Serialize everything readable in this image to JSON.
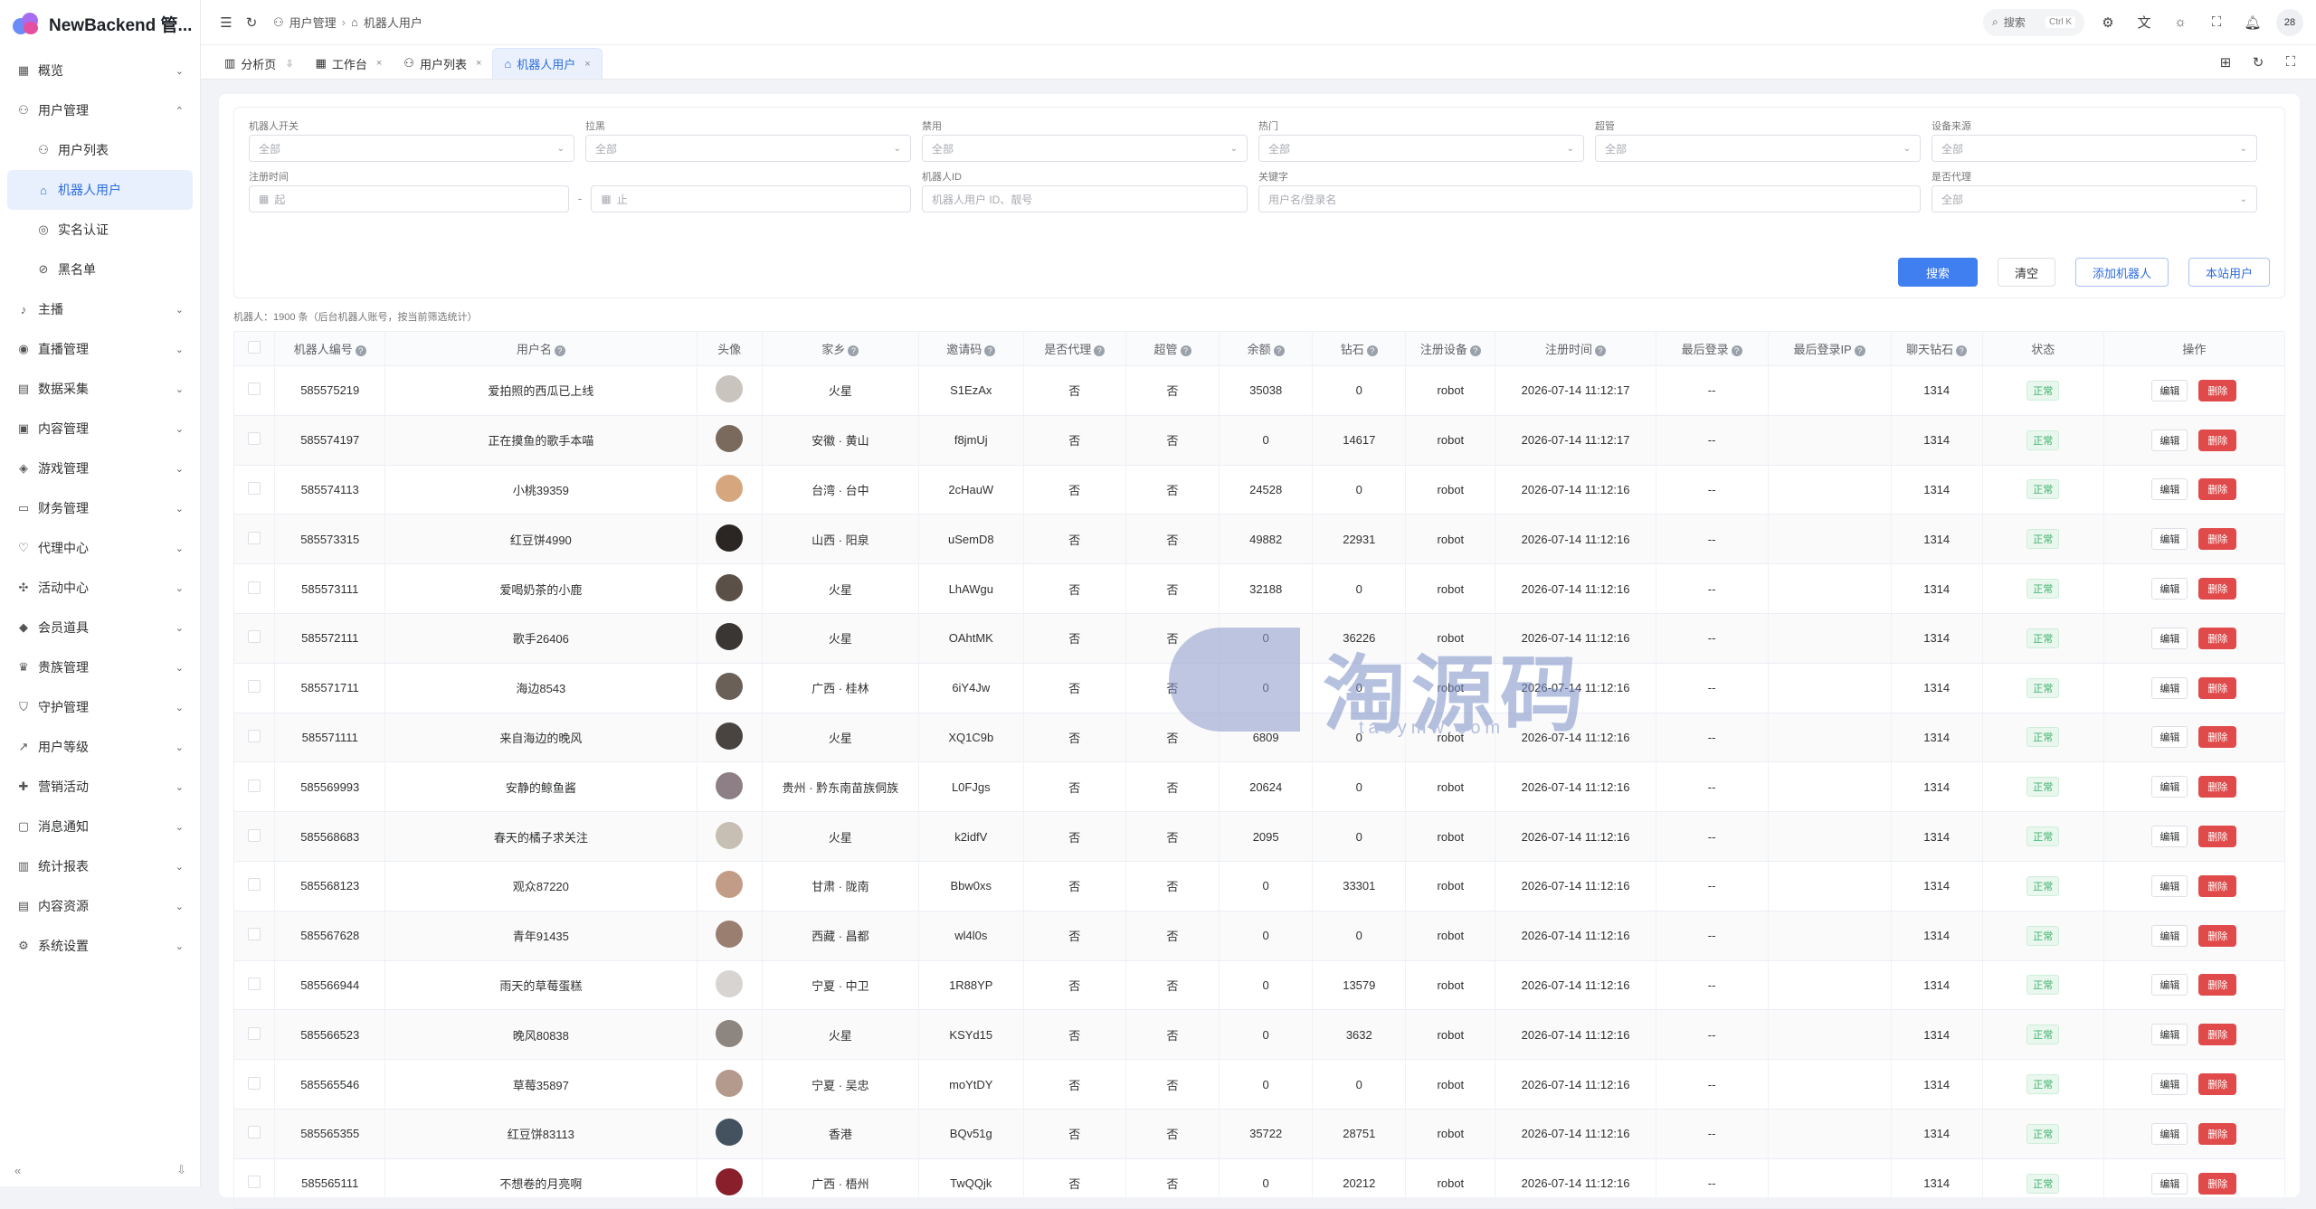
{
  "app": {
    "title": "NewBackend 管...",
    "user_badge": "28"
  },
  "sidebar": {
    "items": [
      {
        "label": "概览",
        "icon": "grid-icon",
        "chev": "⌄"
      },
      {
        "label": "用户管理",
        "icon": "user-icon",
        "chev": "⌃"
      },
      {
        "label": "用户列表",
        "icon": "user-icon",
        "sub": true
      },
      {
        "label": "机器人用户",
        "icon": "robot-icon",
        "sub": true,
        "active": true
      },
      {
        "label": "实名认证",
        "icon": "id-icon",
        "sub": true
      },
      {
        "label": "黑名单",
        "icon": "block-icon",
        "sub": true
      },
      {
        "label": "主播",
        "icon": "mic-icon",
        "chev": "⌄"
      },
      {
        "label": "直播管理",
        "icon": "live-icon",
        "chev": "⌄"
      },
      {
        "label": "数据采集",
        "icon": "database-icon",
        "chev": "⌄"
      },
      {
        "label": "内容管理",
        "icon": "content-icon",
        "chev": "⌄"
      },
      {
        "label": "游戏管理",
        "icon": "game-icon",
        "chev": "⌄"
      },
      {
        "label": "财务管理",
        "icon": "wallet-icon",
        "chev": "⌄"
      },
      {
        "label": "代理中心",
        "icon": "agent-icon",
        "chev": "⌄"
      },
      {
        "label": "活动中心",
        "icon": "activity-icon",
        "chev": "⌄"
      },
      {
        "label": "会员道具",
        "icon": "diamond-icon",
        "chev": "⌄"
      },
      {
        "label": "贵族管理",
        "icon": "crown-icon",
        "chev": "⌄"
      },
      {
        "label": "守护管理",
        "icon": "shield-icon",
        "chev": "⌄"
      },
      {
        "label": "用户等级",
        "icon": "trend-icon",
        "chev": "⌄"
      },
      {
        "label": "营销活动",
        "icon": "gift-icon",
        "chev": "⌄"
      },
      {
        "label": "消息通知",
        "icon": "message-icon",
        "chev": "⌄"
      },
      {
        "label": "统计报表",
        "icon": "chart-icon",
        "chev": "⌄"
      },
      {
        "label": "内容资源",
        "icon": "folder-icon",
        "chev": "⌄"
      },
      {
        "label": "系统设置",
        "icon": "gear-icon",
        "chev": "⌄"
      }
    ],
    "collapse": "«",
    "pin": "⇩"
  },
  "header": {
    "breadcrumb": [
      "用户管理",
      "机器人用户"
    ],
    "search_label": "搜索",
    "search_kbd": "Ctrl K"
  },
  "tabs": [
    {
      "label": "分析页",
      "icon": "chart-icon",
      "close": "⇩"
    },
    {
      "label": "工作台",
      "icon": "desk-icon",
      "close": "×"
    },
    {
      "label": "用户列表",
      "icon": "user-icon",
      "close": "×"
    },
    {
      "label": "机器人用户",
      "icon": "robot-icon",
      "close": "×",
      "active": true
    }
  ],
  "filters": {
    "row1": [
      {
        "label": "机器人开关",
        "value": "全部"
      },
      {
        "label": "拉黑",
        "value": "全部"
      },
      {
        "label": "禁用",
        "value": "全部"
      },
      {
        "label": "热门",
        "value": "全部"
      },
      {
        "label": "超管",
        "value": "全部"
      },
      {
        "label": "设备来源",
        "value": "全部"
      }
    ],
    "reg_time_label": "注册时间",
    "start_placeholder": "起",
    "dash": "-",
    "end_placeholder": "止",
    "robot_id_label": "机器人ID",
    "robot_id_placeholder": "机器人用户 ID、靓号",
    "keyword_label": "关键字",
    "keyword_placeholder": "用户名/登录名",
    "agent_label": "是否代理",
    "agent_value": "全部",
    "buttons": {
      "search": "搜索",
      "clear": "清空",
      "add": "添加机器人",
      "local": "本站用户"
    }
  },
  "summary": "机器人：1900 条（后台机器人账号，按当前筛选统计）",
  "table": {
    "headers": [
      "机器人编号",
      "用户名",
      "头像",
      "家乡",
      "邀请码",
      "是否代理",
      "超管",
      "余额",
      "钻石",
      "注册设备",
      "注册时间",
      "最后登录",
      "最后登录IP",
      "聊天钻石",
      "状态",
      "操作"
    ],
    "edit_label": "编辑",
    "delete_label": "删除",
    "rows": [
      {
        "id": "585575219",
        "name": "爱拍照的西瓜已上线",
        "home": "火星",
        "code": "S1EzAx",
        "agent": "否",
        "admin": "否",
        "balance": "35038",
        "diamond": "0",
        "device": "robot",
        "reg": "2026-07-14 11:12:17",
        "last": "--",
        "ip": "",
        "chat": "1314",
        "status": "正常",
        "color": "#c9c4bd"
      },
      {
        "id": "585574197",
        "name": "正在摸鱼的歌手本喵",
        "home": "安徽 · 黄山",
        "code": "f8jmUj",
        "agent": "否",
        "admin": "否",
        "balance": "0",
        "diamond": "14617",
        "device": "robot",
        "reg": "2026-07-14 11:12:17",
        "last": "--",
        "ip": "",
        "chat": "1314",
        "status": "正常",
        "color": "#7a6a5e"
      },
      {
        "id": "585574113",
        "name": "小桃39359",
        "home": "台湾 · 台中",
        "code": "2cHauW",
        "agent": "否",
        "admin": "否",
        "balance": "24528",
        "diamond": "0",
        "device": "robot",
        "reg": "2026-07-14 11:12:16",
        "last": "--",
        "ip": "",
        "chat": "1314",
        "status": "正常",
        "color": "#d6a77e"
      },
      {
        "id": "585573315",
        "name": "红豆饼4990",
        "home": "山西 · 阳泉",
        "code": "uSemD8",
        "agent": "否",
        "admin": "否",
        "balance": "49882",
        "diamond": "22931",
        "device": "robot",
        "reg": "2026-07-14 11:12:16",
        "last": "--",
        "ip": "",
        "chat": "1314",
        "status": "正常",
        "color": "#2b2623"
      },
      {
        "id": "585573111",
        "name": "爱喝奶茶的小鹿",
        "home": "火星",
        "code": "LhAWgu",
        "agent": "否",
        "admin": "否",
        "balance": "32188",
        "diamond": "0",
        "device": "robot",
        "reg": "2026-07-14 11:12:16",
        "last": "--",
        "ip": "",
        "chat": "1314",
        "status": "正常",
        "color": "#5a5048"
      },
      {
        "id": "585572111",
        "name": "歌手26406",
        "home": "火星",
        "code": "OAhtMK",
        "agent": "否",
        "admin": "否",
        "balance": "0",
        "diamond": "36226",
        "device": "robot",
        "reg": "2026-07-14 11:12:16",
        "last": "--",
        "ip": "",
        "chat": "1314",
        "status": "正常",
        "color": "#3a3634"
      },
      {
        "id": "585571711",
        "name": "海边8543",
        "home": "广西 · 桂林",
        "code": "6iY4Jw",
        "agent": "否",
        "admin": "否",
        "balance": "0",
        "diamond": "0",
        "device": "robot",
        "reg": "2026-07-14 11:12:16",
        "last": "--",
        "ip": "",
        "chat": "1314",
        "status": "正常",
        "color": "#6b6058"
      },
      {
        "id": "585571111",
        "name": "来自海边的晚风",
        "home": "火星",
        "code": "XQ1C9b",
        "agent": "否",
        "admin": "否",
        "balance": "6809",
        "diamond": "0",
        "device": "robot",
        "reg": "2026-07-14 11:12:16",
        "last": "--",
        "ip": "",
        "chat": "1314",
        "status": "正常",
        "color": "#4a4440"
      },
      {
        "id": "585569993",
        "name": "安静的鲸鱼酱",
        "home": "贵州 · 黔东南苗族侗族",
        "code": "L0FJgs",
        "agent": "否",
        "admin": "否",
        "balance": "20624",
        "diamond": "0",
        "device": "robot",
        "reg": "2026-07-14 11:12:16",
        "last": "--",
        "ip": "",
        "chat": "1314",
        "status": "正常",
        "color": "#8e7f86"
      },
      {
        "id": "585568683",
        "name": "春天的橘子求关注",
        "home": "火星",
        "code": "k2idfV",
        "agent": "否",
        "admin": "否",
        "balance": "2095",
        "diamond": "0",
        "device": "robot",
        "reg": "2026-07-14 11:12:16",
        "last": "--",
        "ip": "",
        "chat": "1314",
        "status": "正常",
        "color": "#c7bfb3"
      },
      {
        "id": "585568123",
        "name": "观众87220",
        "home": "甘肃 · 陇南",
        "code": "Bbw0xs",
        "agent": "否",
        "admin": "否",
        "balance": "0",
        "diamond": "33301",
        "device": "robot",
        "reg": "2026-07-14 11:12:16",
        "last": "--",
        "ip": "",
        "chat": "1314",
        "status": "正常",
        "color": "#c29c86"
      },
      {
        "id": "585567628",
        "name": "青年91435",
        "home": "西藏 · 昌都",
        "code": "wl4l0s",
        "agent": "否",
        "admin": "否",
        "balance": "0",
        "diamond": "0",
        "device": "robot",
        "reg": "2026-07-14 11:12:16",
        "last": "--",
        "ip": "",
        "chat": "1314",
        "status": "正常",
        "color": "#9a7e70"
      },
      {
        "id": "585566944",
        "name": "雨天的草莓蛋糕",
        "home": "宁夏 · 中卫",
        "code": "1R88YP",
        "agent": "否",
        "admin": "否",
        "balance": "0",
        "diamond": "13579",
        "device": "robot",
        "reg": "2026-07-14 11:12:16",
        "last": "--",
        "ip": "",
        "chat": "1314",
        "status": "正常",
        "color": "#d7d4d1"
      },
      {
        "id": "585566523",
        "name": "晚风80838",
        "home": "火星",
        "code": "KSYd15",
        "agent": "否",
        "admin": "否",
        "balance": "0",
        "diamond": "3632",
        "device": "robot",
        "reg": "2026-07-14 11:12:16",
        "last": "--",
        "ip": "",
        "chat": "1314",
        "status": "正常",
        "color": "#8d8580"
      },
      {
        "id": "585565546",
        "name": "草莓35897",
        "home": "宁夏 · 吴忠",
        "code": "moYtDY",
        "agent": "否",
        "admin": "否",
        "balance": "0",
        "diamond": "0",
        "device": "robot",
        "reg": "2026-07-14 11:12:16",
        "last": "--",
        "ip": "",
        "chat": "1314",
        "status": "正常",
        "color": "#b39a8c"
      },
      {
        "id": "585565355",
        "name": "红豆饼83113",
        "home": "香港",
        "code": "BQv51g",
        "agent": "否",
        "admin": "否",
        "balance": "35722",
        "diamond": "28751",
        "device": "robot",
        "reg": "2026-07-14 11:12:16",
        "last": "--",
        "ip": "",
        "chat": "1314",
        "status": "正常",
        "color": "#44525f"
      },
      {
        "id": "585565111",
        "name": "不想卷的月亮啊",
        "home": "广西 · 梧州",
        "code": "TwQQjk",
        "agent": "否",
        "admin": "否",
        "balance": "0",
        "diamond": "20212",
        "device": "robot",
        "reg": "2026-07-14 11:12:16",
        "last": "--",
        "ip": "",
        "chat": "1314",
        "status": "正常",
        "color": "#8a1f2c"
      }
    ]
  },
  "watermark": {
    "text": "淘源码",
    "sub": "taoymw.com"
  }
}
